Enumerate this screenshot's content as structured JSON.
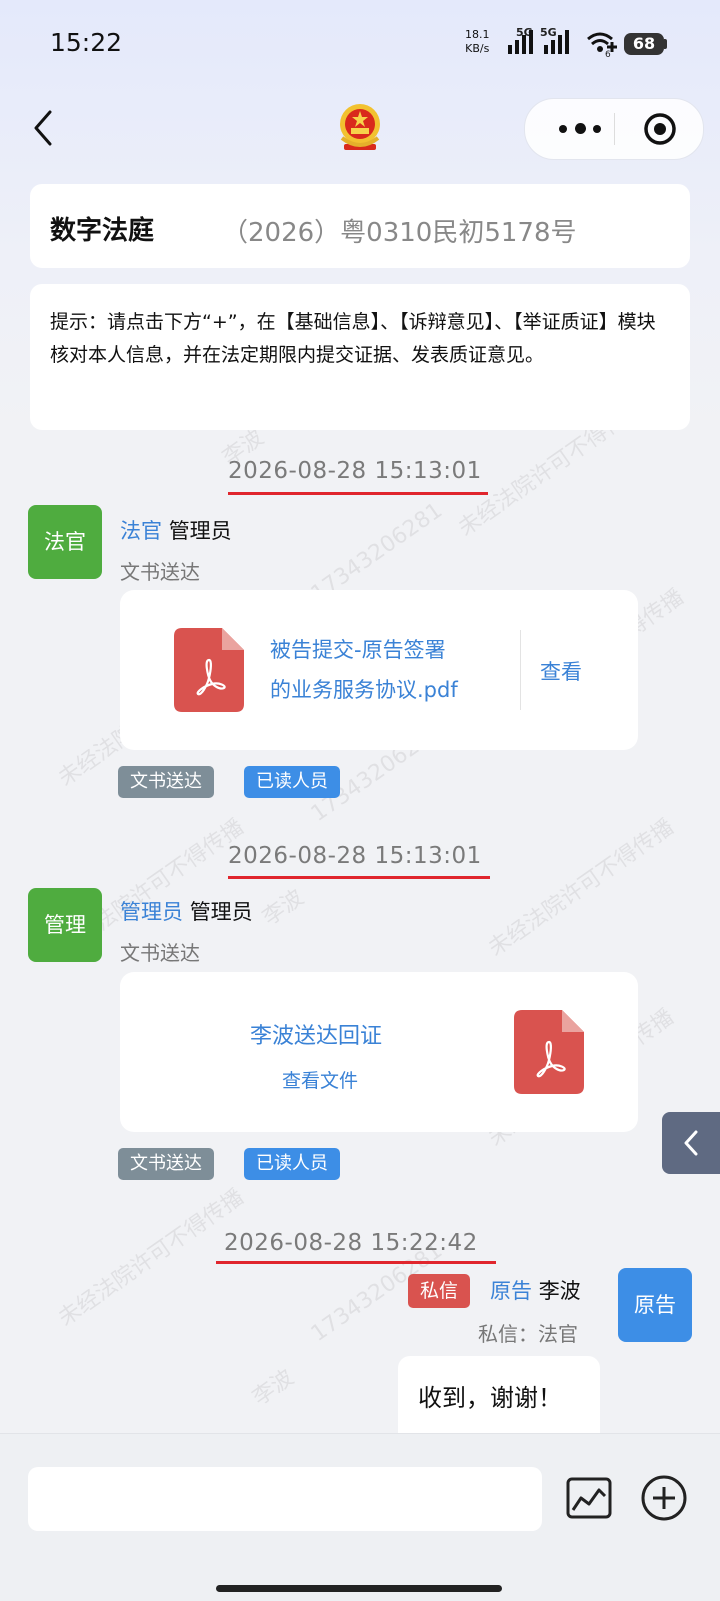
{
  "status": {
    "time": "15:22",
    "speed_value": "18.1",
    "speed_unit": "KB/s",
    "net1": "5G",
    "net2": "5G",
    "wifi_sub": "6",
    "battery": "68"
  },
  "header": {
    "title": "数字法庭",
    "case_no": "（2026）粤0310民初5178号"
  },
  "tip": "提示：请点击下方“+”，在【基础信息】、【诉辩意见】、【举证质证】模块核对本人信息，并在法定期限内提交证据、发表质证意见。",
  "messages": [
    {
      "time": "2026-08-28 15:13:01",
      "avatar": "法官",
      "role": "法官",
      "name": "管理员",
      "type": "文书送达",
      "file_name_line1": "被告提交-原告签署",
      "file_name_line2": "的业务服务协议.pdf",
      "view": "查看",
      "tag_type": "文书送达",
      "tag_read": "已读人员"
    },
    {
      "time": "2026-08-28 15:13:01",
      "avatar": "管理",
      "role": "管理员",
      "name": "管理员",
      "type": "文书送达",
      "file_title": "李波送达回证",
      "file_link": "查看文件",
      "tag_type": "文书送达",
      "tag_read": "已读人员"
    },
    {
      "time": "2026-08-28 15:22:42",
      "avatar": "原告",
      "private_tag": "私信",
      "role": "原告",
      "name": "李波",
      "sub": "私信：法官",
      "text": "收到，谢谢！"
    }
  ],
  "watermark": [
    "未经法院许可不得传播",
    "李波",
    "17343206281"
  ],
  "colors": {
    "accent": "#3a82d6",
    "judge_green": "#4fac3f",
    "red_line": "#e0262d",
    "pdf_red": "#d9534f"
  },
  "icons": [
    "back-icon",
    "emblem-icon",
    "more-icon",
    "target-icon",
    "pdf-icon",
    "chevron-left-icon",
    "image-icon",
    "plus-icon"
  ]
}
